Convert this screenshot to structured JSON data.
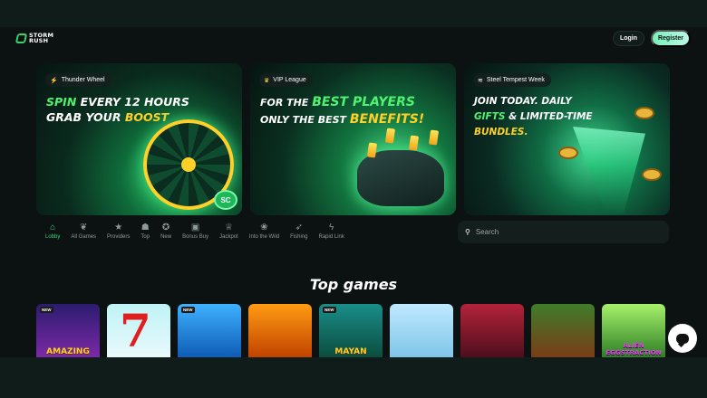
{
  "header": {
    "logo_line1": "STORM",
    "logo_line2": "RUSH",
    "login_label": "Login",
    "register_label": "Register"
  },
  "banners": [
    {
      "tag": "Thunder Wheel",
      "tag_icon": "lightning-icon",
      "line1_a": "SPIN",
      "line1_b": "EVERY 12 HOURS",
      "line2_a": "GRAB YOUR",
      "line2_b": "BOOST",
      "badge": "SC"
    },
    {
      "tag": "VIP League",
      "tag_icon": "crown-icon",
      "line1_a": "FOR THE",
      "line1_b": "BEST PLAYERS",
      "line2_a": "ONLY THE BEST",
      "line2_b": "BENEFITS!"
    },
    {
      "tag": "Steel Tempest Week",
      "tag_icon": "tornado-icon",
      "line1_a": "JOIN TODAY. DAILY",
      "line2_a": "GIFTS",
      "line2_b": "& LIMITED-TIME",
      "line3": "BUNDLES."
    }
  ],
  "nav_tabs": [
    {
      "label": "Lobby",
      "icon": "home-icon",
      "active": true
    },
    {
      "label": "All Games",
      "icon": "cherries-icon",
      "active": false
    },
    {
      "label": "Providers",
      "icon": "star-icon",
      "active": false
    },
    {
      "label": "Top",
      "icon": "ghost-icon",
      "active": false
    },
    {
      "label": "New",
      "icon": "new-badge-icon",
      "active": false
    },
    {
      "label": "Bonus Buy",
      "icon": "gift-icon",
      "active": false
    },
    {
      "label": "Jackpot",
      "icon": "trophy-icon",
      "active": false
    },
    {
      "label": "Into the Wild",
      "icon": "paw-icon",
      "active": false
    },
    {
      "label": "Fishing",
      "icon": "fish-icon",
      "active": false
    },
    {
      "label": "Rapid Link",
      "icon": "lightning-icon",
      "active": false
    }
  ],
  "search": {
    "placeholder": "Search"
  },
  "section_title": "Top games",
  "games": [
    {
      "badge": "NEW",
      "title": "AMAZING"
    },
    {
      "badge": "",
      "title": "7"
    },
    {
      "badge": "NEW",
      "title": ""
    },
    {
      "badge": "",
      "title": ""
    },
    {
      "badge": "NEW",
      "title": "MAYAN"
    },
    {
      "badge": "",
      "title": ""
    },
    {
      "badge": "",
      "title": ""
    },
    {
      "badge": "",
      "title": ""
    },
    {
      "badge": "",
      "title": "ALIEN EGGSTRACTION"
    }
  ],
  "colors": {
    "accent": "#39d680",
    "highlight_green": "#4ff271",
    "highlight_yellow": "#ffd028",
    "background": "#0c1211"
  }
}
